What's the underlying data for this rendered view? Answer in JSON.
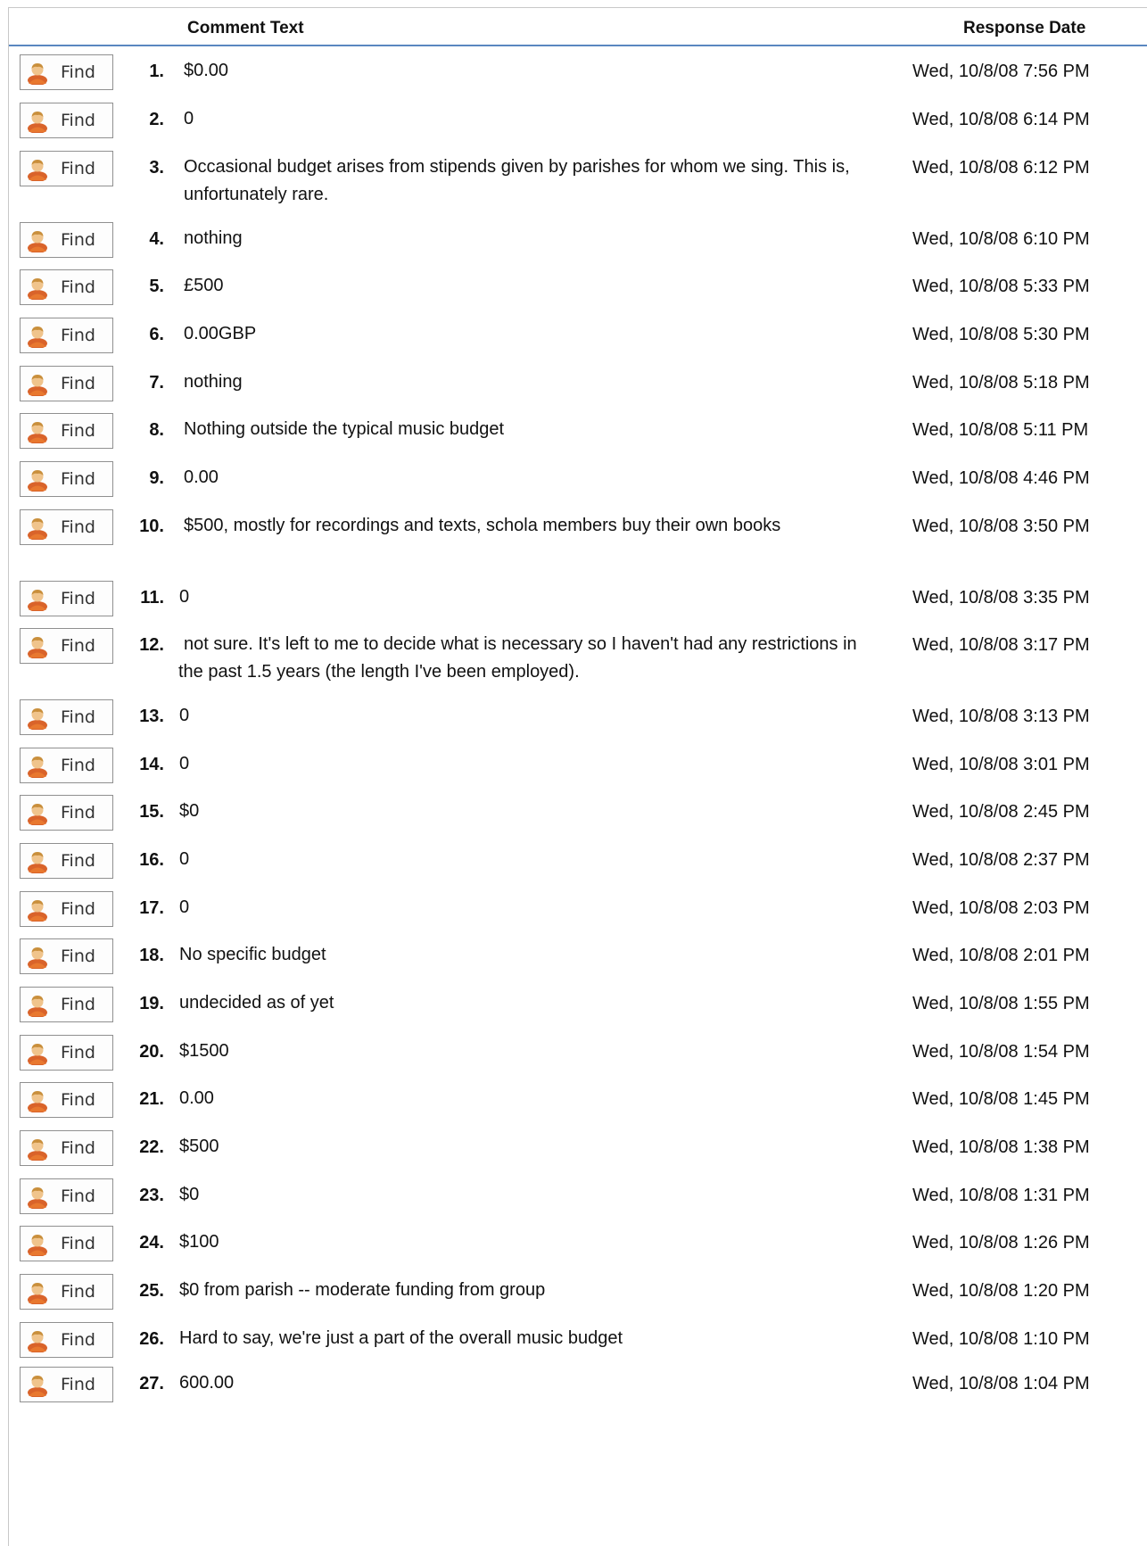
{
  "header": {
    "comment_col": "Comment Text",
    "date_col": "Response Date"
  },
  "find_label": "Find",
  "rows": [
    {
      "num": "1.",
      "text": "$0.00",
      "date": "Wed, 10/8/08 7:56 PM"
    },
    {
      "num": "2.",
      "text": "0",
      "date": "Wed, 10/8/08 6:14 PM"
    },
    {
      "num": "3.",
      "text": "Occasional budget arises from stipends given by parishes for whom we sing. This is, unfortunately rare.",
      "date": "Wed, 10/8/08 6:12 PM"
    },
    {
      "num": "4.",
      "text": "nothing",
      "date": "Wed, 10/8/08 6:10 PM"
    },
    {
      "num": "5.",
      "text": "£500",
      "date": "Wed, 10/8/08 5:33 PM"
    },
    {
      "num": "6.",
      "text": "0.00GBP",
      "date": "Wed, 10/8/08 5:30 PM"
    },
    {
      "num": "7.",
      "text": "nothing",
      "date": "Wed, 10/8/08 5:18 PM"
    },
    {
      "num": "8.",
      "text": "Nothing outside the typical music budget",
      "date": "Wed, 10/8/08 5:11 PM"
    },
    {
      "num": "9.",
      "text": "0.00",
      "date": "Wed, 10/8/08 4:46 PM"
    },
    {
      "num": "10.",
      "text": "$500, mostly for recordings and texts, schola members buy their own books",
      "date": "Wed, 10/8/08 3:50 PM"
    },
    {
      "num": "11.",
      "text": "0",
      "date": "Wed, 10/8/08 3:35 PM"
    },
    {
      "num": "12.",
      "text": "not sure. It's left to me to decide what is necessary so I haven't had any restrictions in the past 1.5 years (the length I've been employed).",
      "date": "Wed, 10/8/08 3:17 PM"
    },
    {
      "num": "13.",
      "text": "0",
      "date": "Wed, 10/8/08 3:13 PM"
    },
    {
      "num": "14.",
      "text": "0",
      "date": "Wed, 10/8/08 3:01 PM"
    },
    {
      "num": "15.",
      "text": "$0",
      "date": "Wed, 10/8/08 2:45 PM"
    },
    {
      "num": "16.",
      "text": "0",
      "date": "Wed, 10/8/08 2:37 PM"
    },
    {
      "num": "17.",
      "text": "0",
      "date": "Wed, 10/8/08 2:03 PM"
    },
    {
      "num": "18.",
      "text": "No specific budget",
      "date": "Wed, 10/8/08 2:01 PM"
    },
    {
      "num": "19.",
      "text": "undecided as of yet",
      "date": "Wed, 10/8/08 1:55 PM"
    },
    {
      "num": "20.",
      "text": "$1500",
      "date": "Wed, 10/8/08 1:54 PM"
    },
    {
      "num": "21.",
      "text": "0.00",
      "date": "Wed, 10/8/08 1:45 PM"
    },
    {
      "num": "22.",
      "text": "$500",
      "date": "Wed, 10/8/08 1:38 PM"
    },
    {
      "num": "23.",
      "text": "$0",
      "date": "Wed, 10/8/08 1:31 PM"
    },
    {
      "num": "24.",
      "text": "$100",
      "date": "Wed, 10/8/08 1:26 PM"
    },
    {
      "num": "25.",
      "text": "$0 from parish -- moderate funding from group",
      "date": "Wed, 10/8/08 1:20 PM"
    },
    {
      "num": "26.",
      "text": "Hard to say, we're just a part of the overall music budget",
      "date": "Wed, 10/8/08 1:10 PM"
    },
    {
      "num": "27.",
      "text": "600.00",
      "date": "Wed, 10/8/08 1:04 PM"
    }
  ]
}
